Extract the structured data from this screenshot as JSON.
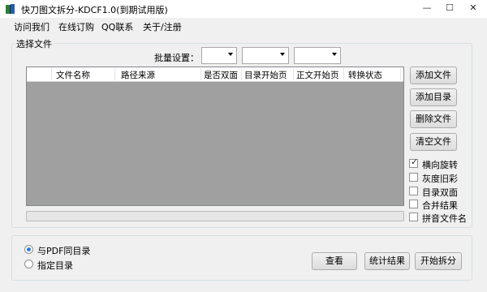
{
  "window": {
    "title": "快刀图文拆分-KDCF1.0(到期试用版)",
    "controls": {
      "minimize": "—",
      "maximize": "☐",
      "close": "✕"
    }
  },
  "menu": [
    "访问我们",
    "在线订购",
    "QQ联系",
    "关于/注册"
  ],
  "file_group": {
    "title": "选择文件",
    "batch_label": "批量设置：",
    "combos": [
      "",
      "",
      ""
    ],
    "table_columns": [
      "文件名称",
      "路径来源",
      "是否双面",
      "目录开始页",
      "正文开始页",
      "转换状态"
    ],
    "buttons": [
      "添加文件",
      "添加目录",
      "删除文件",
      "清空文件"
    ],
    "options": [
      {
        "label": "横向旋转",
        "checked": true
      },
      {
        "label": "灰度旧彩",
        "checked": false
      },
      {
        "label": "目录双面",
        "checked": false
      },
      {
        "label": "合并结果",
        "checked": false
      },
      {
        "label": "拼音文件名",
        "checked": false
      }
    ],
    "progress": 0
  },
  "output_group": {
    "radios": [
      {
        "label": "与PDF同目录",
        "selected": true
      },
      {
        "label": "指定目录",
        "selected": false
      }
    ],
    "buttons": [
      "查看",
      "统计结果",
      "开始拆分"
    ]
  }
}
